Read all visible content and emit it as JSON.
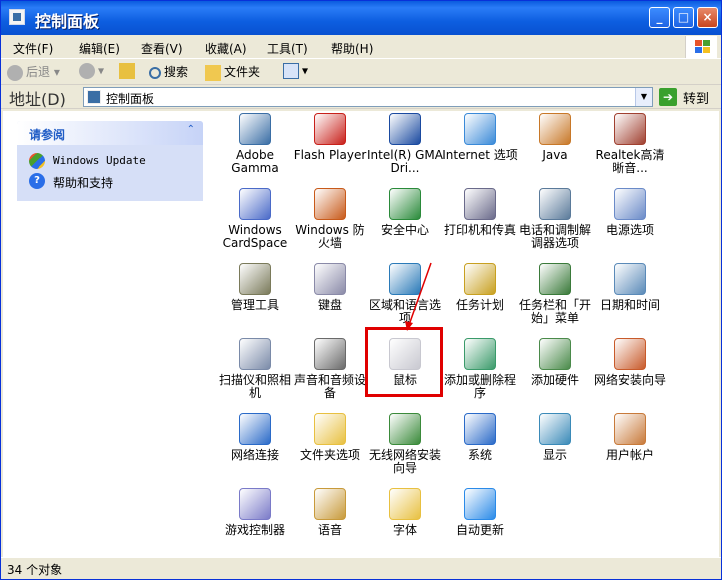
{
  "window": {
    "title": "控制面板",
    "buttons": {
      "minimize": "_",
      "maximize": "□",
      "close": "×"
    }
  },
  "menu": [
    "文件(F)",
    "编辑(E)",
    "查看(V)",
    "收藏(A)",
    "工具(T)",
    "帮助(H)"
  ],
  "toolbar": {
    "back": "后退",
    "search": "搜索",
    "folders": "文件夹"
  },
  "address": {
    "label": "地址(D)",
    "value": "控制面板",
    "go": "转到"
  },
  "side_panel": {
    "title": "请参阅",
    "links": [
      "Windows Update",
      "帮助和支持"
    ]
  },
  "items": [
    "Adobe Gamma",
    "Flash Player",
    "Intel(R) GMA Dri...",
    "Internet 选项",
    "Java",
    "Realtek高清晰音...",
    "Windows CardSpace",
    "Windows 防火墙",
    "安全中心",
    "打印机和传真",
    "电话和调制解调器选项",
    "电源选项",
    "管理工具",
    "键盘",
    "区域和语言选项",
    "任务计划",
    "任务栏和「开始」菜单",
    "日期和时间",
    "扫描仪和照相机",
    "声音和音频设备",
    "鼠标",
    "添加或删除程序",
    "添加硬件",
    "网络安装向导",
    "网络连接",
    "文件夹选项",
    "无线网络安装向导",
    "系统",
    "显示",
    "用户帐户",
    "游戏控制器",
    "语音",
    "字体",
    "自动更新"
  ],
  "status": {
    "text": "34 个对象"
  },
  "colors": {
    "titlebar": "#0a5bde",
    "highlight": "#e00000",
    "panel": "#d6dff7"
  }
}
